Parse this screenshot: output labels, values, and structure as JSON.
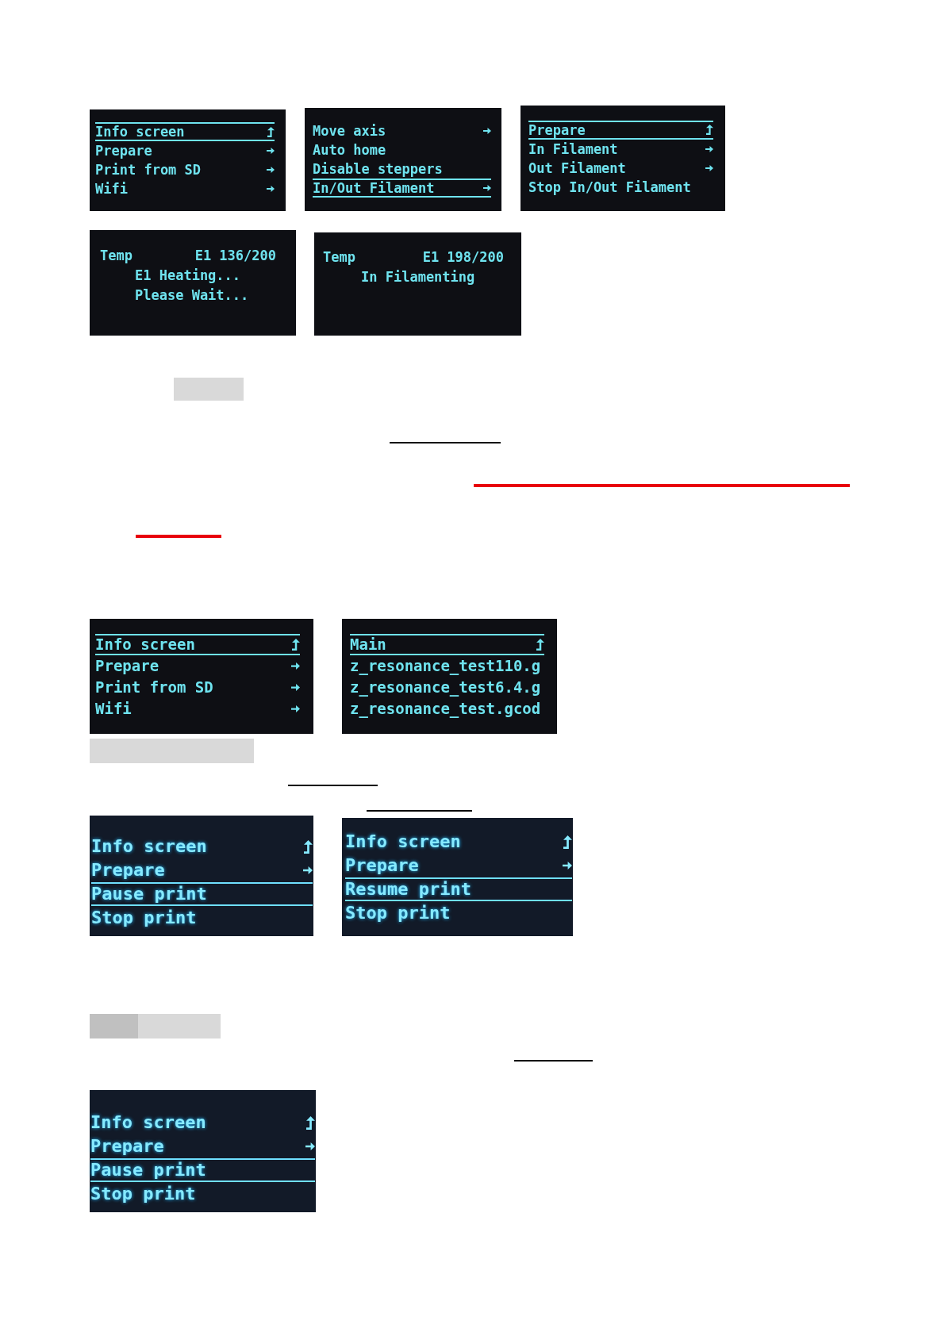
{
  "rows": [
    {
      "screens": [
        {
          "kind": "menu",
          "items": [
            {
              "label": "Info screen",
              "kind": "back",
              "selected": true
            },
            {
              "label": "Prepare",
              "kind": "submenu",
              "selected": false
            },
            {
              "label": "Print from SD",
              "kind": "submenu",
              "selected": false
            },
            {
              "label": "Wifi",
              "kind": "submenu",
              "selected": false
            }
          ]
        },
        {
          "kind": "menu",
          "items": [
            {
              "label": "Move axis",
              "kind": "submenu",
              "selected": false
            },
            {
              "label": "Auto home",
              "kind": "action",
              "selected": false
            },
            {
              "label": "Disable steppers",
              "kind": "action",
              "selected": false
            },
            {
              "label": "In/Out Filament",
              "kind": "submenu",
              "selected": true
            }
          ]
        },
        {
          "kind": "menu",
          "items": [
            {
              "label": "Prepare",
              "kind": "back",
              "selected": true
            },
            {
              "label": "In Filament",
              "kind": "submenu",
              "selected": false
            },
            {
              "label": "Out Filament",
              "kind": "submenu",
              "selected": false
            },
            {
              "label": "Stop In/Out Filament",
              "kind": "action",
              "selected": false
            }
          ]
        }
      ]
    },
    {
      "screens": [
        {
          "kind": "status",
          "label": "Temp",
          "reading": "E1 136/200",
          "messages": [
            "E1 Heating...",
            "Please Wait..."
          ]
        },
        {
          "kind": "status",
          "label": "Temp",
          "reading": "E1 198/200",
          "messages": [
            "In Filamenting"
          ]
        }
      ]
    },
    {
      "screens": [
        {
          "kind": "menu",
          "items": [
            {
              "label": "Info screen",
              "kind": "back",
              "selected": true
            },
            {
              "label": "Prepare",
              "kind": "submenu",
              "selected": false
            },
            {
              "label": "Print from SD",
              "kind": "submenu",
              "selected": false
            },
            {
              "label": "Wifi",
              "kind": "submenu",
              "selected": false
            }
          ]
        },
        {
          "kind": "menu",
          "items": [
            {
              "label": "Main",
              "kind": "back",
              "selected": true
            },
            {
              "label": "z_resonance_test110.g",
              "kind": "action",
              "selected": false
            },
            {
              "label": "z_resonance_test6.4.g",
              "kind": "action",
              "selected": false
            },
            {
              "label": "z_resonance_test.gcod",
              "kind": "action",
              "selected": false
            }
          ]
        }
      ]
    },
    {
      "screens": [
        {
          "kind": "menu",
          "items": [
            {
              "label": "Info screen",
              "kind": "back",
              "selected": false
            },
            {
              "label": "Prepare",
              "kind": "submenu",
              "selected": false
            },
            {
              "label": "Pause print",
              "kind": "action",
              "selected": true
            },
            {
              "label": "Stop print",
              "kind": "action",
              "selected": false
            }
          ]
        },
        {
          "kind": "menu",
          "items": [
            {
              "label": "Info screen",
              "kind": "back",
              "selected": false
            },
            {
              "label": "Prepare",
              "kind": "submenu",
              "selected": false
            },
            {
              "label": "Resume print",
              "kind": "action",
              "selected": true
            },
            {
              "label": "Stop print",
              "kind": "action",
              "selected": false
            }
          ]
        }
      ]
    },
    {
      "screens": [
        {
          "kind": "menu",
          "items": [
            {
              "label": "Info screen",
              "kind": "back",
              "selected": false
            },
            {
              "label": "Prepare",
              "kind": "submenu",
              "selected": false
            },
            {
              "label": "Pause print",
              "kind": "action",
              "selected": true
            },
            {
              "label": "Stop print",
              "kind": "action",
              "selected": false
            }
          ]
        }
      ]
    }
  ]
}
